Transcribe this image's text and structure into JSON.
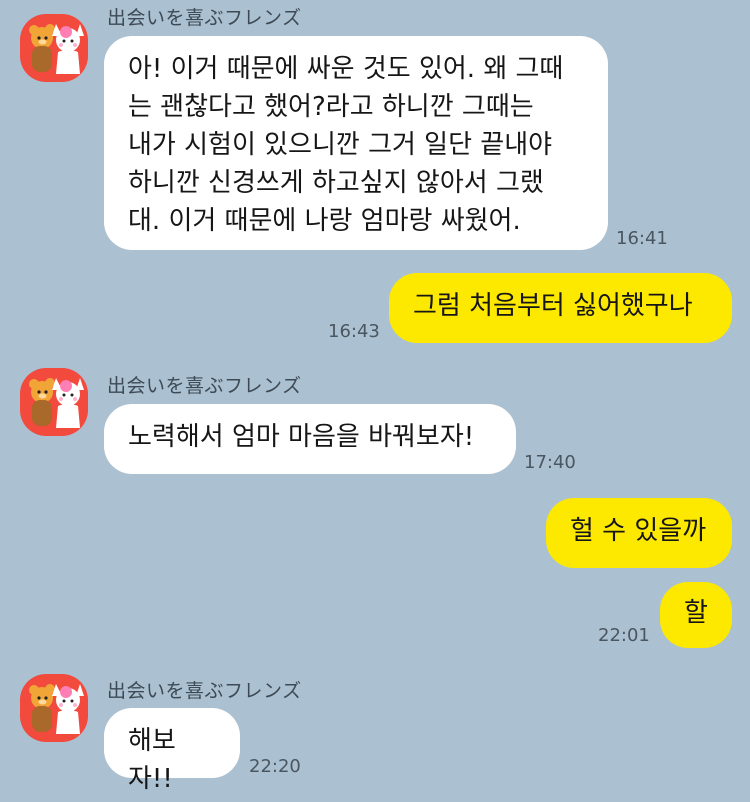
{
  "chat": {
    "messages": [
      {
        "sender": "出会いを喜ぶフレンズ",
        "text": "아! 이거 때문에 싸운 것도 있어. 왜 그때\n는 괜찮다고 했어?라고 하니깐 그때는\n내가 시험이 있으니깐 그거 일단 끝내야\n하니깐 신경쓰게 하고싶지 않아서 그랬\n대. 이거 때문에 나랑 엄마랑 싸웠어.",
        "time": "16:41"
      },
      {
        "text": "그럼 처음부터 싫어했구나",
        "time": "16:43"
      },
      {
        "sender": "出会いを喜ぶフレンズ",
        "text": "노력해서 엄마 마음을 바꿔보자!",
        "time": "17:40"
      },
      {
        "text": "헐 수 있을까",
        "time": ""
      },
      {
        "text": "할",
        "time": "22:01"
      },
      {
        "sender": "出会いを喜ぶフレンズ",
        "text": "해보자!!",
        "time": "22:20"
      }
    ]
  },
  "colors": {
    "background": "#abc1d1",
    "incoming_bubble": "#ffffff",
    "outgoing_bubble": "#fde800",
    "avatar_bg": "#f24a3c"
  },
  "icons": {
    "avatar": "bear-and-cat-avatar-icon"
  }
}
